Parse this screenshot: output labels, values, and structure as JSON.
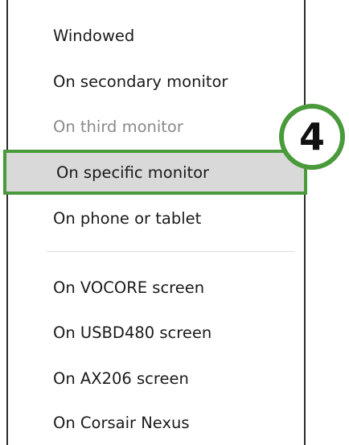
{
  "menu": {
    "items": [
      {
        "label": "Windowed",
        "state": "normal"
      },
      {
        "label": "On secondary monitor",
        "state": "normal"
      },
      {
        "label": "On third monitor",
        "state": "disabled"
      },
      {
        "label": "On specific monitor",
        "state": "selected"
      },
      {
        "label": "On phone or tablet",
        "state": "normal"
      },
      {
        "label": "On VOCORE screen",
        "state": "normal"
      },
      {
        "label": "On USBD480 screen",
        "state": "normal"
      },
      {
        "label": "On AX206 screen",
        "state": "normal"
      },
      {
        "label": "On Corsair Nexus",
        "state": "normal"
      }
    ]
  },
  "badge": {
    "number": "4"
  },
  "colors": {
    "highlight_border": "#4a9a3c",
    "selected_background": "#d9d9d9",
    "disabled_text": "#8a8a8a",
    "menu_border": "#2b2b2b"
  }
}
